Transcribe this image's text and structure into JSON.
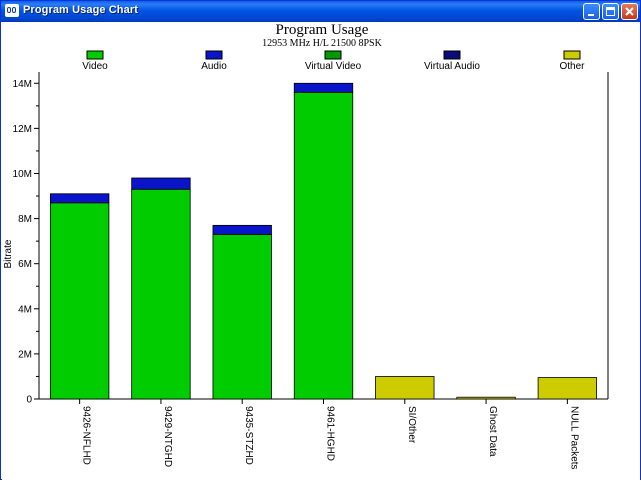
{
  "window": {
    "title": "Program Usage Chart",
    "buttons": [
      "minimize",
      "maximize",
      "close"
    ]
  },
  "chart_data": {
    "type": "bar",
    "stacked": true,
    "title": "Program Usage",
    "subtitle": "12953 MHz H/L 21500 8PSK",
    "ylabel": "Bitrate",
    "xlabel": "",
    "ylim": [
      0,
      14500000
    ],
    "yticks": [
      0,
      2000000,
      4000000,
      6000000,
      8000000,
      10000000,
      12000000,
      14000000
    ],
    "ytick_labels": [
      "0",
      "2M",
      "4M",
      "6M",
      "8M",
      "10M",
      "12M",
      "14M"
    ],
    "grid": false,
    "legend_position": "top",
    "legend": [
      {
        "name": "Video",
        "color": "#00cc00"
      },
      {
        "name": "Audio",
        "color": "#0a14c8"
      },
      {
        "name": "Virtual Video",
        "color": "#009900"
      },
      {
        "name": "Virtual Audio",
        "color": "#0a0a7a"
      },
      {
        "name": "Other",
        "color": "#cccc00"
      }
    ],
    "categories": [
      "9426-NFLHD",
      "9429-NTGHD",
      "9435-STZHD",
      "9461-HGHD",
      "SI/Other",
      "Ghost Data",
      "NULL Packets"
    ],
    "series": [
      {
        "name": "Video",
        "color": "#00cc00",
        "values": [
          8700000,
          9300000,
          7300000,
          13600000,
          0,
          0,
          0
        ]
      },
      {
        "name": "Audio",
        "color": "#0a14c8",
        "values": [
          400000,
          500000,
          400000,
          400000,
          0,
          0,
          0
        ]
      },
      {
        "name": "Virtual Video",
        "color": "#009900",
        "values": [
          0,
          0,
          0,
          0,
          0,
          0,
          0
        ]
      },
      {
        "name": "Virtual Audio",
        "color": "#0a0a7a",
        "values": [
          0,
          0,
          0,
          0,
          0,
          0,
          0
        ]
      },
      {
        "name": "Other",
        "color": "#cccc00",
        "values": [
          0,
          0,
          0,
          0,
          1000000,
          80000,
          950000
        ]
      }
    ]
  }
}
